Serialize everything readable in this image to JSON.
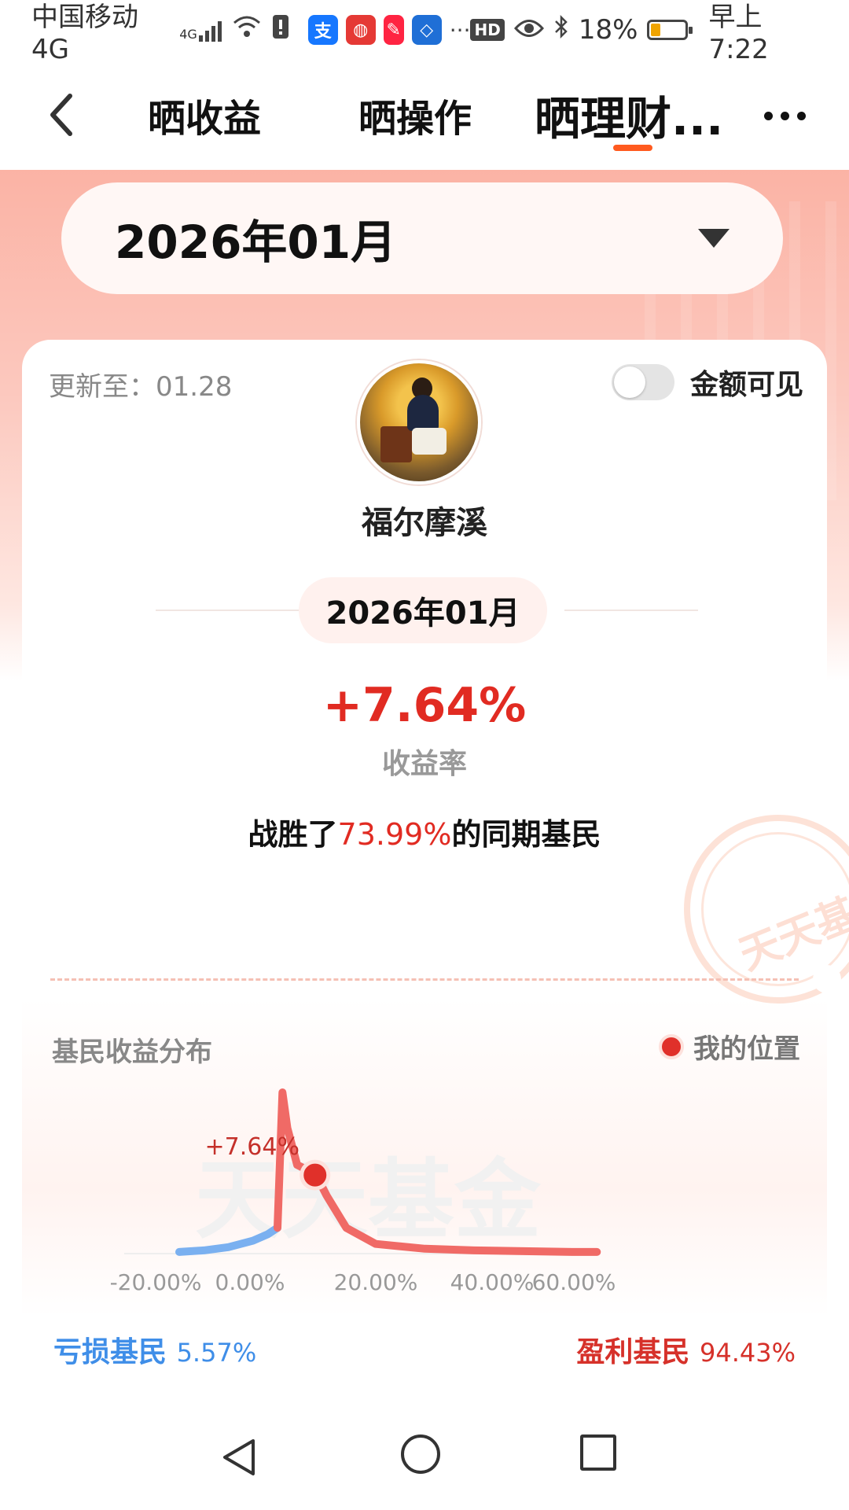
{
  "status_bar": {
    "carrier": "中国移动4G",
    "network_sup": "4G",
    "hd": "HD",
    "battery": "18%",
    "time": "早上7:22"
  },
  "nav": {
    "tabs": [
      {
        "label": "晒收益",
        "active": false
      },
      {
        "label": "晒操作",
        "active": false
      },
      {
        "label": "晒理财...",
        "active": true
      }
    ]
  },
  "month_selector": {
    "value": "2026年01月"
  },
  "card": {
    "update_text": "更新至：01.28",
    "amount_visible_label": "金额可见",
    "amount_visible_on": false,
    "username": "福尔摩溪",
    "period": "2026年01月",
    "return_value": "+7.64%",
    "return_label": "收益率",
    "beat_prefix": "战胜了",
    "beat_percent": "73.99%",
    "beat_suffix": "的同期基民",
    "stamp_text": "天天基金"
  },
  "distribution": {
    "title": "基民收益分布",
    "legend_label": "我的位置",
    "loss_label": "亏损基民",
    "loss_value": "5.57%",
    "gain_label": "盈利基民",
    "gain_value": "94.43%"
  },
  "chart_data": {
    "type": "area",
    "watermark": "天天基金",
    "x_ticks": [
      "-20.00%",
      "0.00%",
      "20.00%",
      "40.00%",
      "60.00%"
    ],
    "marker": {
      "x": 7.64,
      "label": "+7.64%"
    },
    "loss_series": {
      "color": "#7ab0f0",
      "x": [
        -20,
        -15,
        -10,
        -5,
        -2,
        0
      ],
      "y": [
        0.01,
        0.02,
        0.04,
        0.08,
        0.12,
        0.16
      ]
    },
    "gain_series": {
      "color": "#f06a66",
      "x": [
        0,
        1,
        2,
        4,
        6,
        8,
        10,
        14,
        20,
        30,
        40,
        50,
        60,
        65
      ],
      "y": [
        0.16,
        1.0,
        0.78,
        0.55,
        0.52,
        0.48,
        0.36,
        0.16,
        0.06,
        0.03,
        0.02,
        0.015,
        0.01,
        0.01
      ]
    }
  },
  "colors": {
    "accent": "#ff5a1f",
    "positive": "#e12b22",
    "negative": "#3f8ee8"
  }
}
